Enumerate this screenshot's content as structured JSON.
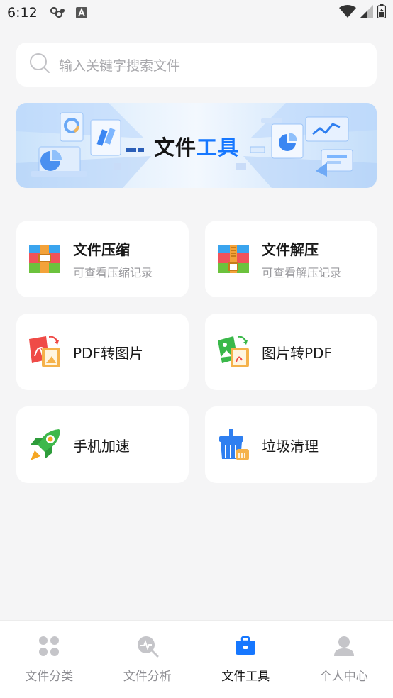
{
  "status_bar": {
    "time": "6:12",
    "icons": [
      "network-icon",
      "a-notification-icon",
      "wifi-icon",
      "signal-icon",
      "battery-icon"
    ]
  },
  "search": {
    "placeholder": "输入关键字搜索文件"
  },
  "banner": {
    "title_part1": "文件",
    "title_part2": "工具"
  },
  "tools": [
    {
      "title": "文件压缩",
      "subtitle": "可查看压缩记录",
      "icon": "zip-archive-icon"
    },
    {
      "title": "文件解压",
      "subtitle": "可查看解压记录",
      "icon": "unzip-archive-icon"
    },
    {
      "title": "PDF转图片",
      "icon": "pdf-to-image-icon"
    },
    {
      "title": "图片转PDF",
      "icon": "image-to-pdf-icon"
    },
    {
      "title": "手机加速",
      "icon": "rocket-icon"
    },
    {
      "title": "垃圾清理",
      "icon": "broom-clean-icon"
    }
  ],
  "tabbar": {
    "active": "文件工具",
    "tabs": [
      {
        "label": "文件分类",
        "icon": "category-grid-icon"
      },
      {
        "label": "文件分析",
        "icon": "analysis-icon"
      },
      {
        "label": "文件工具",
        "icon": "toolbox-icon"
      },
      {
        "label": "个人中心",
        "icon": "person-icon"
      }
    ]
  },
  "colors": {
    "accent": "#1677ff",
    "background": "#f5f5f6",
    "inactive_tab": "#8e8e93"
  }
}
